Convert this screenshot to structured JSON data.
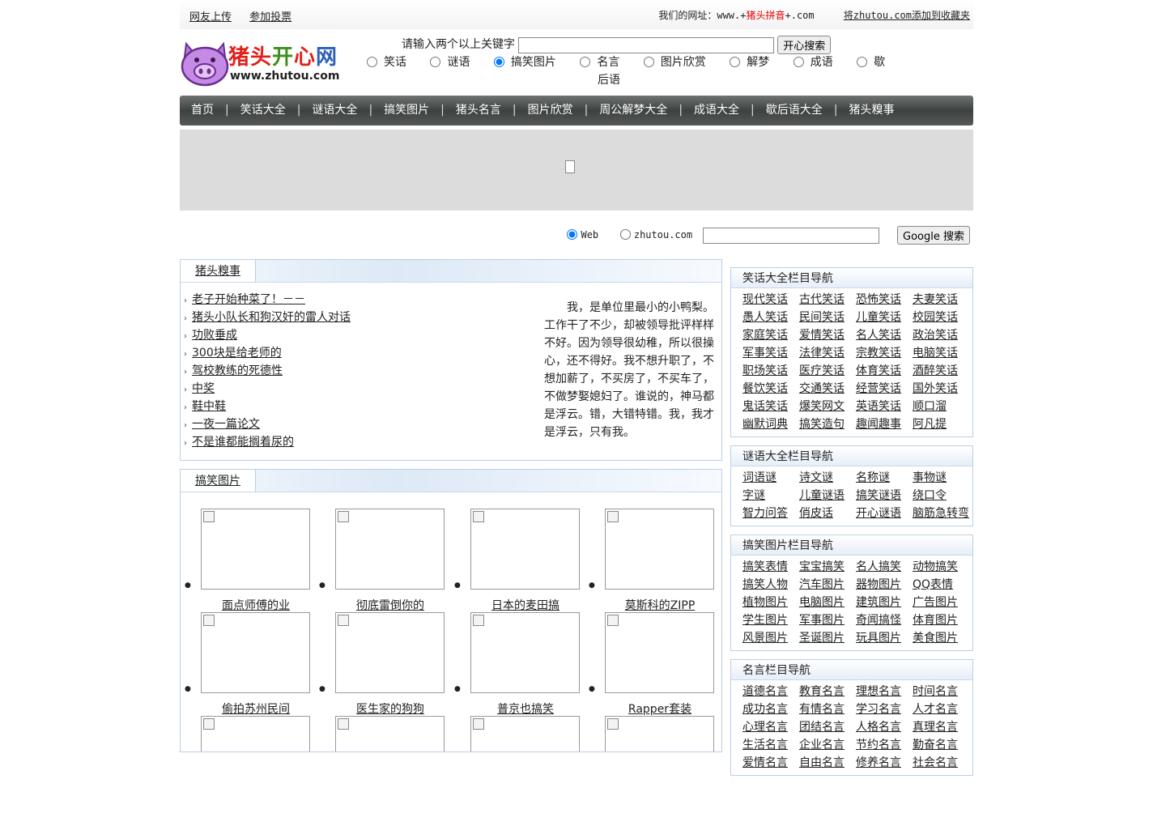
{
  "topbar": {
    "links": [
      "网友上传",
      "参加投票"
    ],
    "address_prefix": "我们的网址：www.+",
    "address_highlight": "猪头拼音",
    "address_suffix": "+.com",
    "bookmark": "将zhutou.com添加到收藏夹"
  },
  "logo": {
    "name_part1": "猪头",
    "name_part2": "开",
    "name_part3": "心",
    "name_part4": "网",
    "url": "www.zhutou.com"
  },
  "search": {
    "label": "请输入两个以上关键字",
    "button": "开心搜索",
    "options": [
      "笑话",
      "谜语",
      "搞笑图片",
      "名言",
      "图片欣赏",
      "解梦",
      "成语",
      "歇"
    ],
    "options_overflow": "后语",
    "selected": "搞笑图片"
  },
  "nav": [
    "首页",
    "笑话大全",
    "谜语大全",
    "搞笑图片",
    "猪头名言",
    "图片欣赏",
    "周公解梦大全",
    "成语大全",
    "歇后语大全",
    "猪头糗事"
  ],
  "google": {
    "opt_web": "Web",
    "opt_site": "zhutou.com",
    "button": "Google 搜索"
  },
  "qiushi": {
    "tab": "猪头糗事",
    "items": [
      "老子开始种菜了！－－",
      "猪头小队长和狗汉奸的雷人对话",
      "功败垂成",
      "300块是给老师的",
      "驾校教练的死德性",
      "中奖",
      "鞋中鞋",
      "一夜一篇论文",
      "不是谁都能搁着尿的"
    ],
    "story": "我，是单位里最小的小鸭梨。工作干了不少，却被领导批评样样不好。因为领导很幼稚，所以很操心，还不得好。我不想升职了，不想加薪了，不买房了，不买车了，不做梦娶媳妇了。谁说的，神马都是浮云。错，大错特错。我，我才是浮云，只有我。"
  },
  "pictures": {
    "tab": "搞笑图片",
    "captions": [
      "面点师傅的业",
      "彻底雷倒你的",
      "日本的麦田搞",
      "莫斯科的ZIPP",
      "偷拍苏州民间",
      "医生家的狗狗",
      "普京也搞笑",
      "Rapper套装",
      "",
      "",
      "",
      ""
    ]
  },
  "sidebar": [
    {
      "title": "笑话大全栏目导航",
      "links": [
        "现代笑话",
        "古代笑话",
        "恐怖笑话",
        "夫妻笑话",
        "愚人笑话",
        "民间笑话",
        "儿童笑话",
        "校园笑话",
        "家庭笑话",
        "爱情笑话",
        "名人笑话",
        "政治笑话",
        "军事笑话",
        "法律笑话",
        "宗教笑话",
        "电脑笑话",
        "职场笑话",
        "医疗笑话",
        "体育笑话",
        "酒醉笑话",
        "餐饮笑话",
        "交通笑话",
        "经营笑话",
        "国外笑话",
        "鬼话笑话",
        "爆笑网文",
        "英语笑话",
        "顺口溜",
        "幽默词典",
        "搞笑造句",
        "趣闻趣事",
        "阿凡提"
      ]
    },
    {
      "title": "谜语大全栏目导航",
      "links": [
        "词语谜",
        "诗文谜",
        "名称谜",
        "事物谜",
        "字谜",
        "儿童谜语",
        "搞笑谜语",
        "绕口令",
        "智力问答",
        "俏皮话",
        "开心谜语",
        "脑筋急转弯"
      ]
    },
    {
      "title": "搞笑图片栏目导航",
      "links": [
        "搞笑表情",
        "宝宝搞笑",
        "名人搞笑",
        "动物搞笑",
        "搞笑人物",
        "汽车图片",
        "器物图片",
        "QQ表情",
        "植物图片",
        "电脑图片",
        "建筑图片",
        "广告图片",
        "学生图片",
        "军事图片",
        "奇闻搞怪",
        "体育图片",
        "风景图片",
        "圣诞图片",
        "玩具图片",
        "美食图片"
      ]
    },
    {
      "title": "名言栏目导航",
      "links": [
        "道德名言",
        "教育名言",
        "理想名言",
        "时间名言",
        "成功名言",
        "有情名言",
        "学习名言",
        "人才名言",
        "心理名言",
        "团结名言",
        "人格名言",
        "真理名言",
        "生活名言",
        "企业名言",
        "节约名言",
        "勤奋名言",
        "爱情名言",
        "自由名言",
        "修养名言",
        "社会名言"
      ]
    }
  ]
}
